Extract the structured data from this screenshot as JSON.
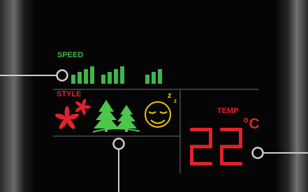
{
  "display": {
    "speed_label": "SPEED",
    "style_label": "STYLE",
    "temp_label": "TEMP",
    "temperature_value": "22",
    "temperature_unit": "°C",
    "speed_level": 1.0,
    "speed_bar_count": 11,
    "modes": [
      "fan-icon",
      "forest-icon",
      "sleep-face-icon"
    ],
    "sleep_indicator": "z z"
  },
  "colors": {
    "background": "#050505",
    "speed_green": "#3fb54a",
    "red": "#e0232a",
    "tree_green": "#4cc74b",
    "yellow": "#f1c40f",
    "divider": "#3a3a3a",
    "callout": "#cfcfcf"
  }
}
